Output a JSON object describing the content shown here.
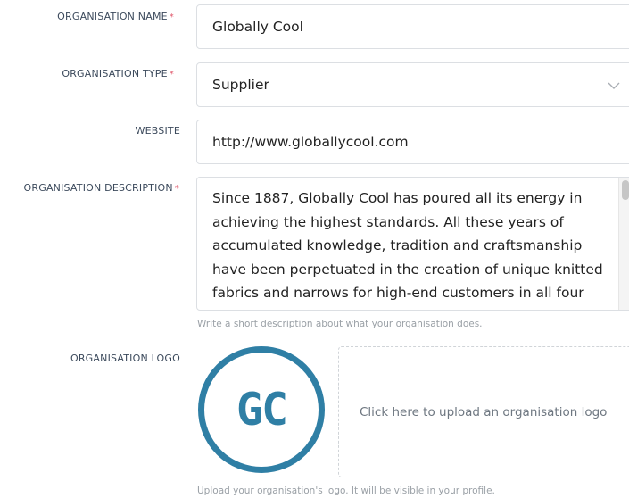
{
  "form": {
    "name": {
      "label": "ORGANISATION NAME",
      "required_mark": "*",
      "value": "Globally Cool"
    },
    "type": {
      "label": "ORGANISATION TYPE",
      "required_mark": "*",
      "value": "Supplier"
    },
    "website": {
      "label": "WEBSITE",
      "value": "http://www.globallycool.com"
    },
    "description": {
      "label": "ORGANISATION DESCRIPTION",
      "required_mark": "*",
      "value": "Since 1887, Globally Cool has poured all its energy in achieving the highest standards. All these years of accumulated knowledge, tradition and craftsmanship have been perpetuated in the creation of unique knitted fabrics and narrows for high-end customers in all four corners of the world.",
      "help": "Write a short description about what your organisation does."
    },
    "logo": {
      "label": "ORGANISATION LOGO",
      "logo_text": "GC",
      "upload_text": "Click here to upload an organisation logo",
      "help": "Upload your organisation's logo. It will be visible in your profile."
    }
  },
  "colors": {
    "accent": "#2f7fa5",
    "required": "#e0566a",
    "border": "#dcdfe3"
  }
}
